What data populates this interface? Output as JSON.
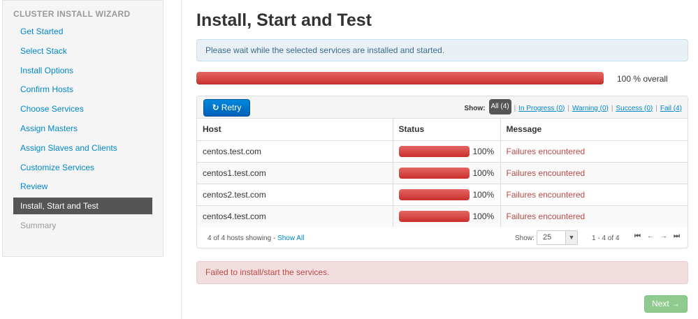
{
  "sidebar": {
    "title": "CLUSTER INSTALL WIZARD",
    "items": [
      {
        "label": "Get Started",
        "state": "link"
      },
      {
        "label": "Select Stack",
        "state": "link"
      },
      {
        "label": "Install Options",
        "state": "link"
      },
      {
        "label": "Confirm Hosts",
        "state": "link"
      },
      {
        "label": "Choose Services",
        "state": "link"
      },
      {
        "label": "Assign Masters",
        "state": "link"
      },
      {
        "label": "Assign Slaves and Clients",
        "state": "link"
      },
      {
        "label": "Customize Services",
        "state": "link"
      },
      {
        "label": "Review",
        "state": "link"
      },
      {
        "label": "Install, Start and Test",
        "state": "active"
      },
      {
        "label": "Summary",
        "state": "disabled"
      }
    ]
  },
  "main": {
    "title": "Install, Start and Test",
    "info_message": "Please wait while the selected services are installed and started.",
    "overall_progress": 100,
    "overall_label": "100 % overall",
    "retry_label": "Retry",
    "filters": {
      "show_label": "Show:",
      "all": "All (4)",
      "in_progress": "In Progress (0)",
      "warning": "Warning (0)",
      "success": "Success (0)",
      "fail": "Fail (4)"
    },
    "table": {
      "headers": [
        "Host",
        "Status",
        "Message"
      ],
      "rows": [
        {
          "host": "centos.test.com",
          "progress": 100,
          "percent": "100%",
          "message": "Failures encountered"
        },
        {
          "host": "centos1.test.com",
          "progress": 100,
          "percent": "100%",
          "message": "Failures encountered"
        },
        {
          "host": "centos2.test.com",
          "progress": 100,
          "percent": "100%",
          "message": "Failures encountered"
        },
        {
          "host": "centos4.test.com",
          "progress": 100,
          "percent": "100%",
          "message": "Failures encountered"
        }
      ]
    },
    "footer": {
      "count_text": "4 of 4 hosts showing - ",
      "show_all": "Show All",
      "show_label": "Show:",
      "page_size": "25",
      "range": "1 - 4 of 4"
    },
    "error_message": "Failed to install/start the services.",
    "next_label": "Next →"
  },
  "colors": {
    "progress_fail": "#d9534f",
    "link": "#0088cc",
    "primary_button": "#0074cc",
    "next_button_disabled": "#8fcb8f"
  }
}
